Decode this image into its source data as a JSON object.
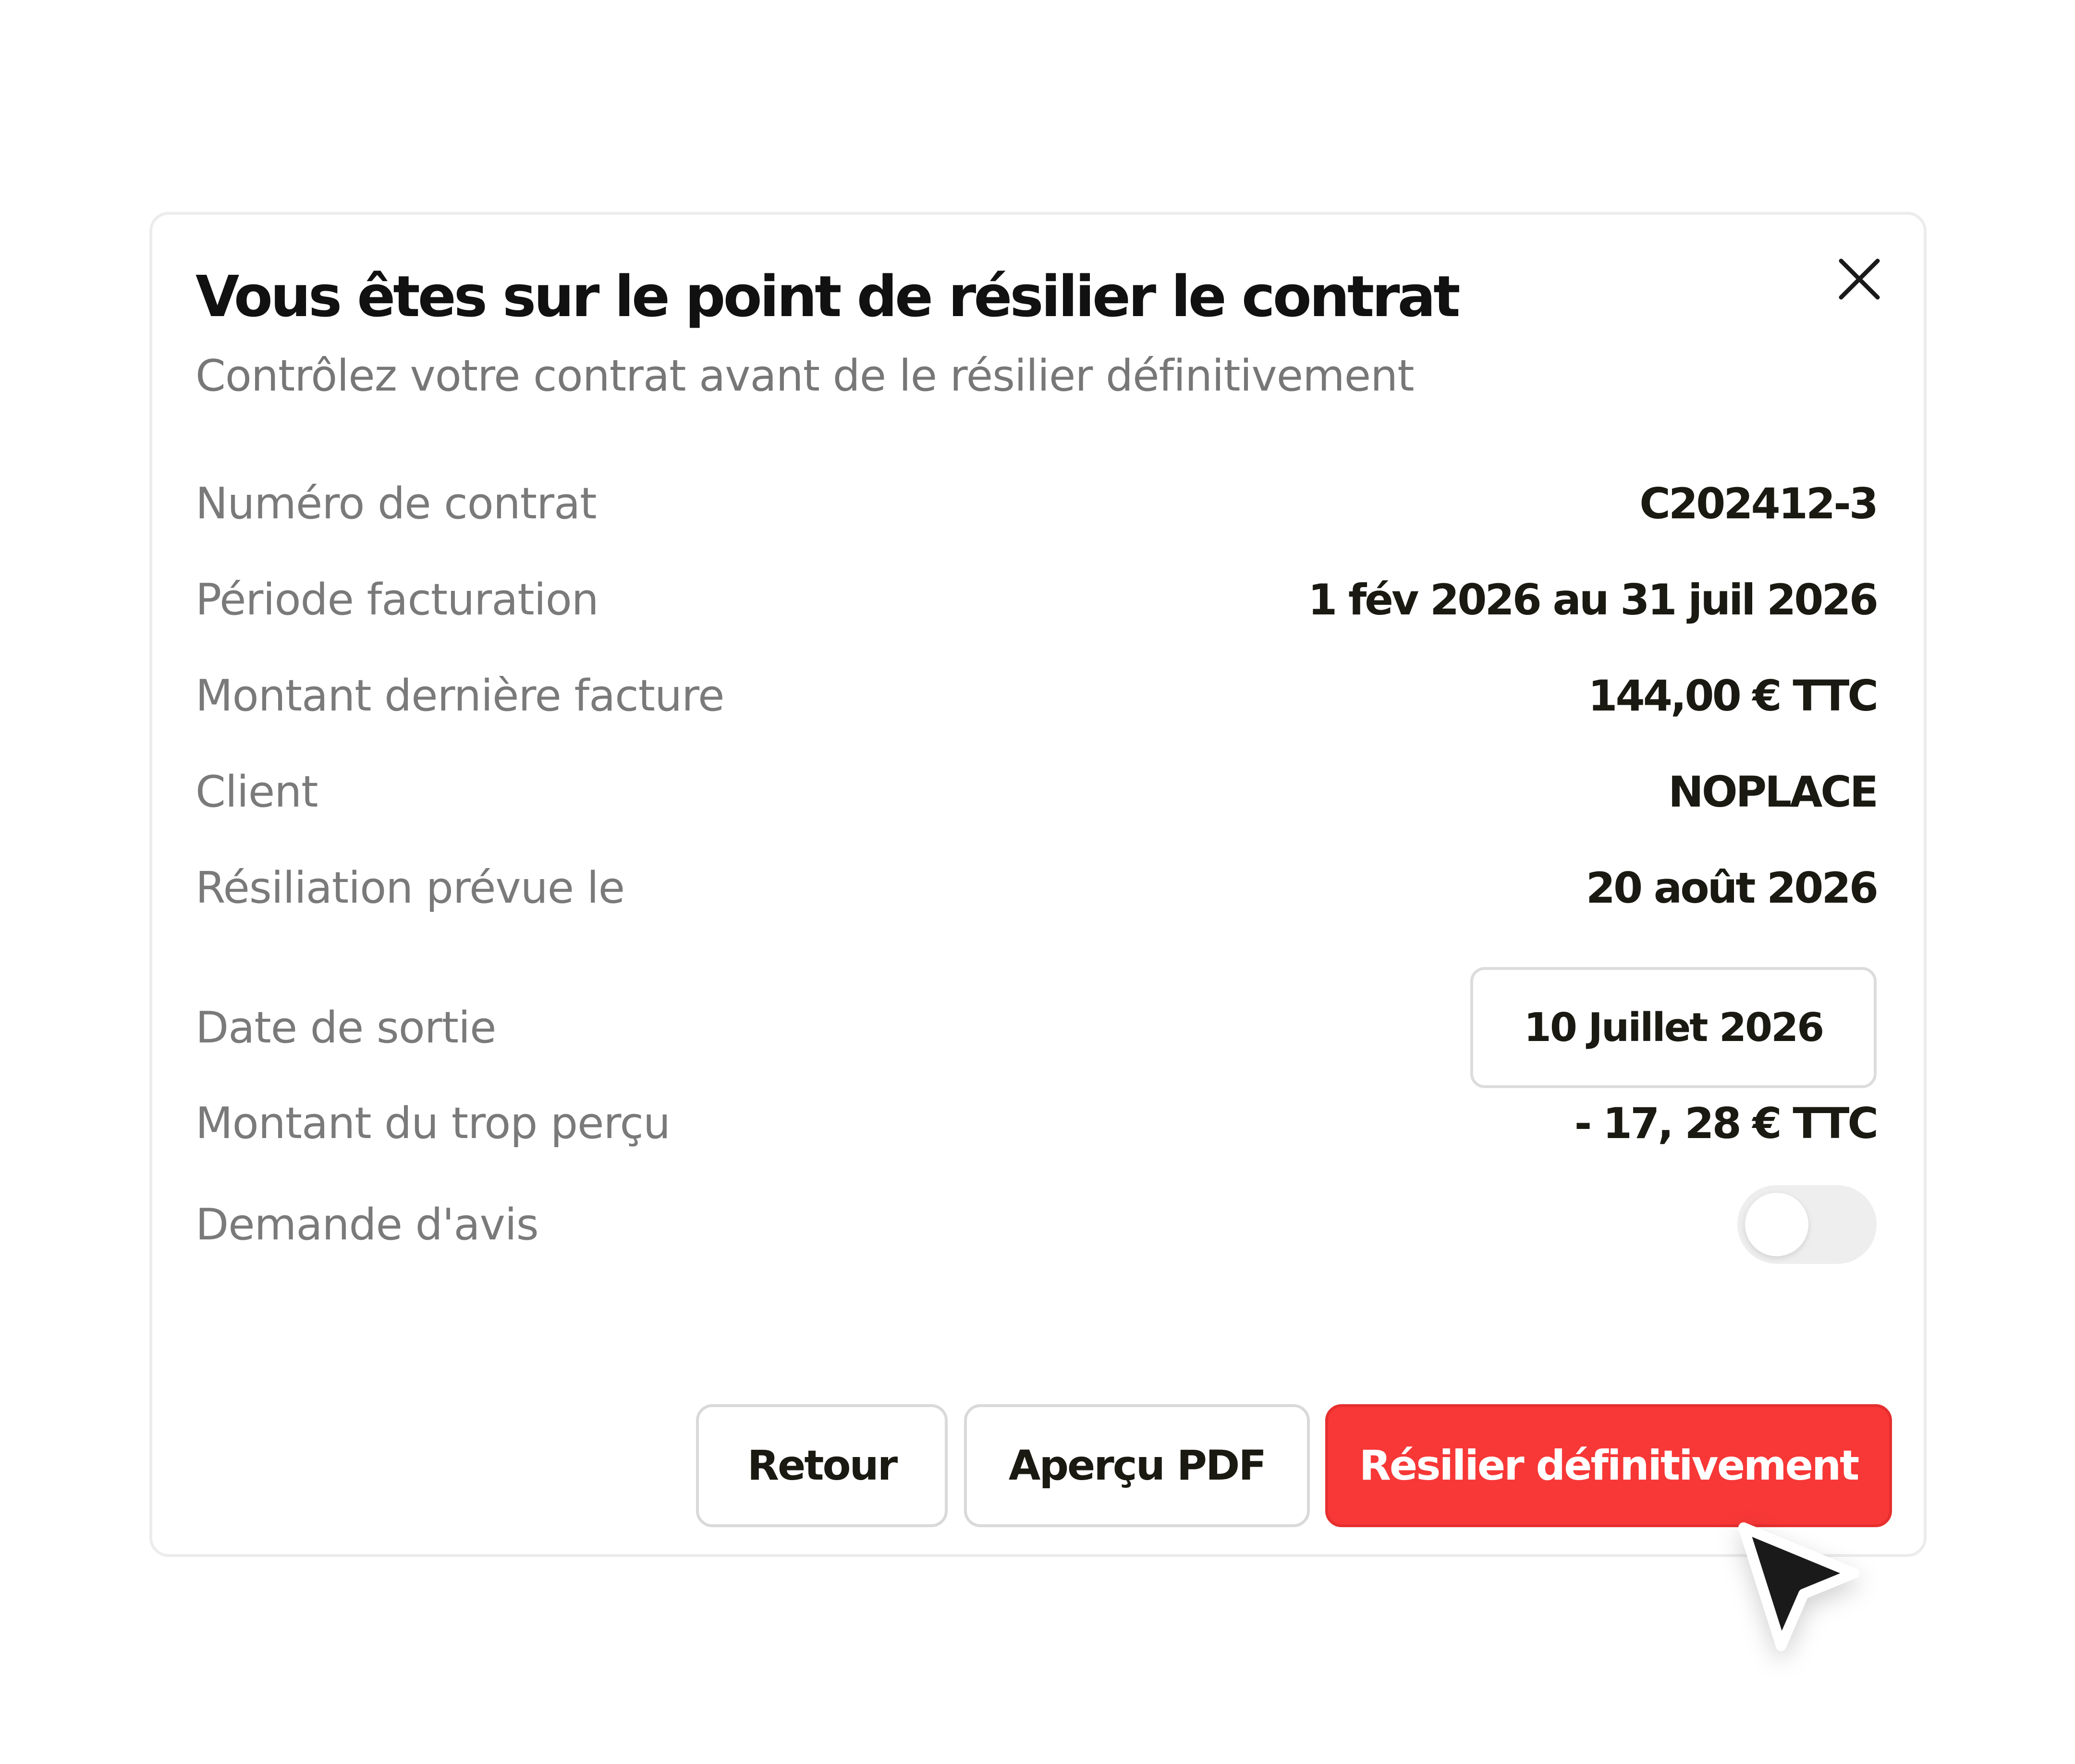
{
  "dialog": {
    "title": "Vous êtes sur le point de résilier le contrat",
    "subtitle": "Contrôlez votre contrat avant de le résilier définitivement",
    "close_icon": "close-icon"
  },
  "details": {
    "contract_number": {
      "label": "Numéro de contrat",
      "value": "C202412-3"
    },
    "billing_period": {
      "label": "Période facturation",
      "value": "1 fév 2026 au 31 juil 2026"
    },
    "last_invoice": {
      "label": "Montant dernière facture",
      "value": "144,00 € TTC"
    },
    "client": {
      "label": "Client",
      "value": "NOPLACE"
    },
    "planned_termination": {
      "label": "Résiliation prévue le",
      "value": "20 août 2026"
    },
    "exit_date": {
      "label": "Date de sortie",
      "value": "10 Juillet 2026"
    },
    "overpayment": {
      "label": "Montant du trop perçu",
      "value": "- 17, 28 € TTC"
    },
    "review_request": {
      "label": "Demande d'avis",
      "enabled": false
    }
  },
  "actions": {
    "back_label": "Retour",
    "preview_label": "Aperçu PDF",
    "terminate_label": "Résilier définitivement"
  },
  "colors": {
    "danger": "#f73837",
    "text_primary": "#1a1a12",
    "text_secondary": "#7a7a7a",
    "border": "#d9d9d9"
  },
  "cursor_icon": "arrow-pointer-icon"
}
